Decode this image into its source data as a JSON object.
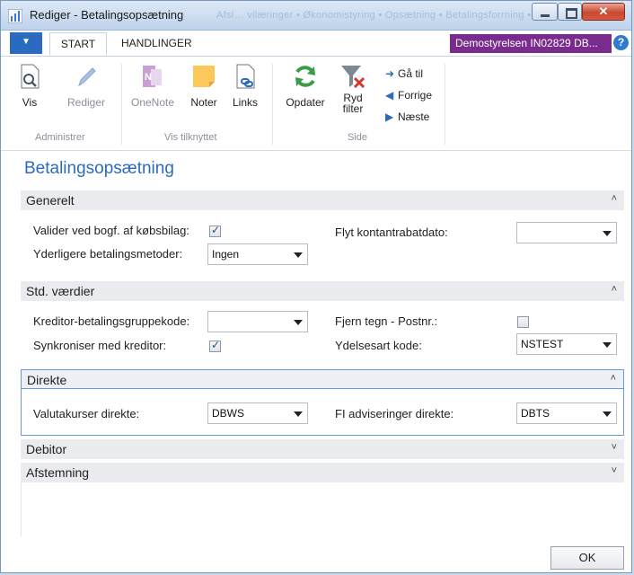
{
  "window": {
    "title": "Rediger - Betalingsopsætning",
    "ghost_breadcrumb": "Afsl… vilæringer  •  Økonomistyring  •  Opsætning  •  Betalingsforrning  •"
  },
  "tabs": {
    "file_glyph": "▼",
    "start": "START",
    "handlinger": "HANDLINGER"
  },
  "company": "Demostyrelsen IN02829 DB...",
  "help_glyph": "?",
  "ribbon": {
    "vis": "Vis",
    "rediger": "Rediger",
    "onenote": "OneNote",
    "noter": "Noter",
    "links": "Links",
    "opdater": "Opdater",
    "ryd_filter": "Ryd filter",
    "gaa_til": "Gå til",
    "forrige": "Forrige",
    "naeste": "Næste",
    "group_administrer": "Administrer",
    "group_vis_tilknyttet": "Vis tilknyttet",
    "group_side": "Side"
  },
  "page": {
    "title": "Betalingsopsætning"
  },
  "sections": {
    "generelt": "Generelt",
    "std_vaerdier": "Std. værdier",
    "direkte": "Direkte",
    "debitor": "Debitor",
    "afstemning": "Afstemning"
  },
  "fields": {
    "valider_label": "Valider ved bogf. af købsbilag:",
    "valider_checked": true,
    "yderligere_label": "Yderligere betalingsmetoder:",
    "yderligere_value": "Ingen",
    "flyt_label": "Flyt kontantrabatdato:",
    "flyt_value": "",
    "kreditor_label": "Kreditor-betalingsgruppekode:",
    "kreditor_value": "",
    "synkroniser_label": "Synkroniser med kreditor:",
    "synkroniser_checked": true,
    "fjern_label": "Fjern tegn - Postnr.:",
    "fjern_checked": false,
    "ydelsesart_label": "Ydelsesart kode:",
    "ydelsesart_value": "NSTEST",
    "valutakurser_label": "Valutakurser direkte:",
    "valutakurser_value": "DBWS",
    "fi_label": "FI adviseringer direkte:",
    "fi_value": "DBTS"
  },
  "chevrons": {
    "up": "˄",
    "down": "˅"
  },
  "ok_label": "OK",
  "colors": {
    "accent_blue": "#2b6bbf",
    "company_purple": "#7a2c8e",
    "section_bg": "#e9ebef",
    "focus_border": "#6c9ad8"
  }
}
